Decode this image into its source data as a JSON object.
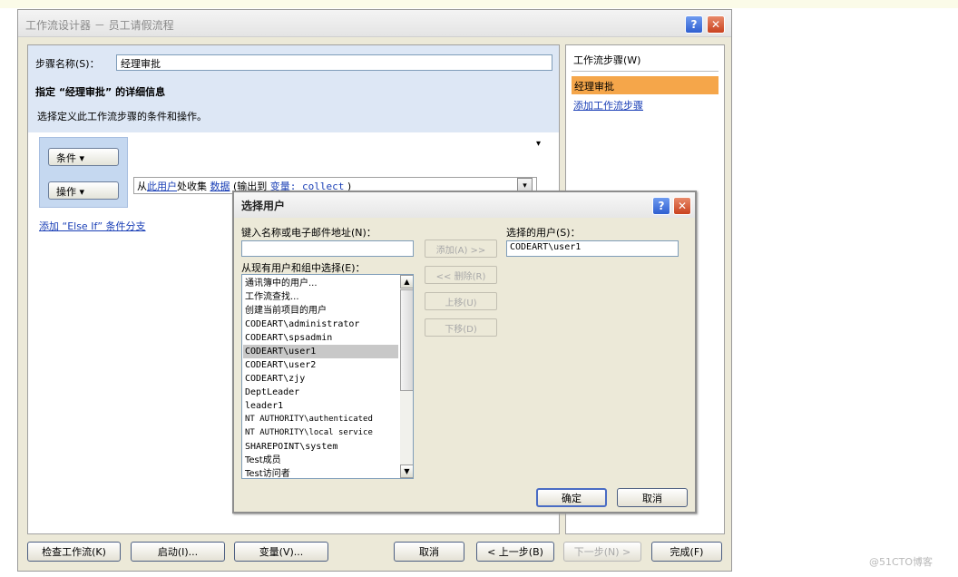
{
  "main_window": {
    "title": "工作流设计器 － 员工请假流程",
    "help_glyph": "?",
    "close_glyph": "✕",
    "step_name_label": "步骤名称(S)：",
    "step_name_value": "经理审批",
    "detail_heading": "指定 “经理审批” 的详细信息",
    "choose_heading": "选择定义此工作流步骤的条件和操作。",
    "conditions_button": "条件 ▾",
    "actions_button": "操作 ▾",
    "action_dropdown_glyph": "▾",
    "action_sentence": {
      "prefix": "从",
      "user_link": "此用户",
      "middle": "处收集",
      "data_link": "数据",
      "paren_open": "(输出到",
      "variable_link": "变量: collect",
      "paren_close": ")"
    },
    "combo_arrow_glyph": "▾",
    "add_else_if": "添加 “Else If” 条件分支",
    "right_panel": {
      "title": "工作流步骤(W)",
      "selected_step": "经理审批",
      "add_step_link": "添加工作流步骤"
    },
    "bottom_buttons": {
      "check": "检查工作流(K)",
      "start": "启动(I)...",
      "variables": "变量(V)...",
      "cancel": "取消",
      "back": "< 上一步(B)",
      "next": "下一步(N) >",
      "finish": "完成(F)"
    }
  },
  "select_user_dialog": {
    "title": "选择用户",
    "help_glyph": "?",
    "close_glyph": "✕",
    "name_label": "键入名称或电子邮件地址(N)：",
    "name_value": "",
    "list_label": "从现有用户和组中选择(E)：",
    "users": [
      "通讯簿中的用户...",
      "工作流查找...",
      "创建当前项目的用户",
      "CODEART\\administrator",
      "CODEART\\spsadmin",
      "CODEART\\user1",
      "CODEART\\user2",
      "CODEART\\zjy",
      "DeptLeader",
      "leader1",
      "NT AUTHORITY\\authenticated",
      "NT AUTHORITY\\local service",
      "SHAREPOINT\\system",
      "Test成员",
      "Test访问者"
    ],
    "scroll_up_glyph": "▲",
    "scroll_down_glyph": "▼",
    "add_button": "添加(A) >>",
    "remove_button": "<< 删除(R)",
    "move_up_button": "上移(U)",
    "move_down_button": "下移(D)",
    "selected_users_label": "选择的用户(S)：",
    "selected_users_value": "CODEART\\user1",
    "ok_button": "确定",
    "cancel_button": "取消"
  },
  "watermark": "@51CTO博客"
}
